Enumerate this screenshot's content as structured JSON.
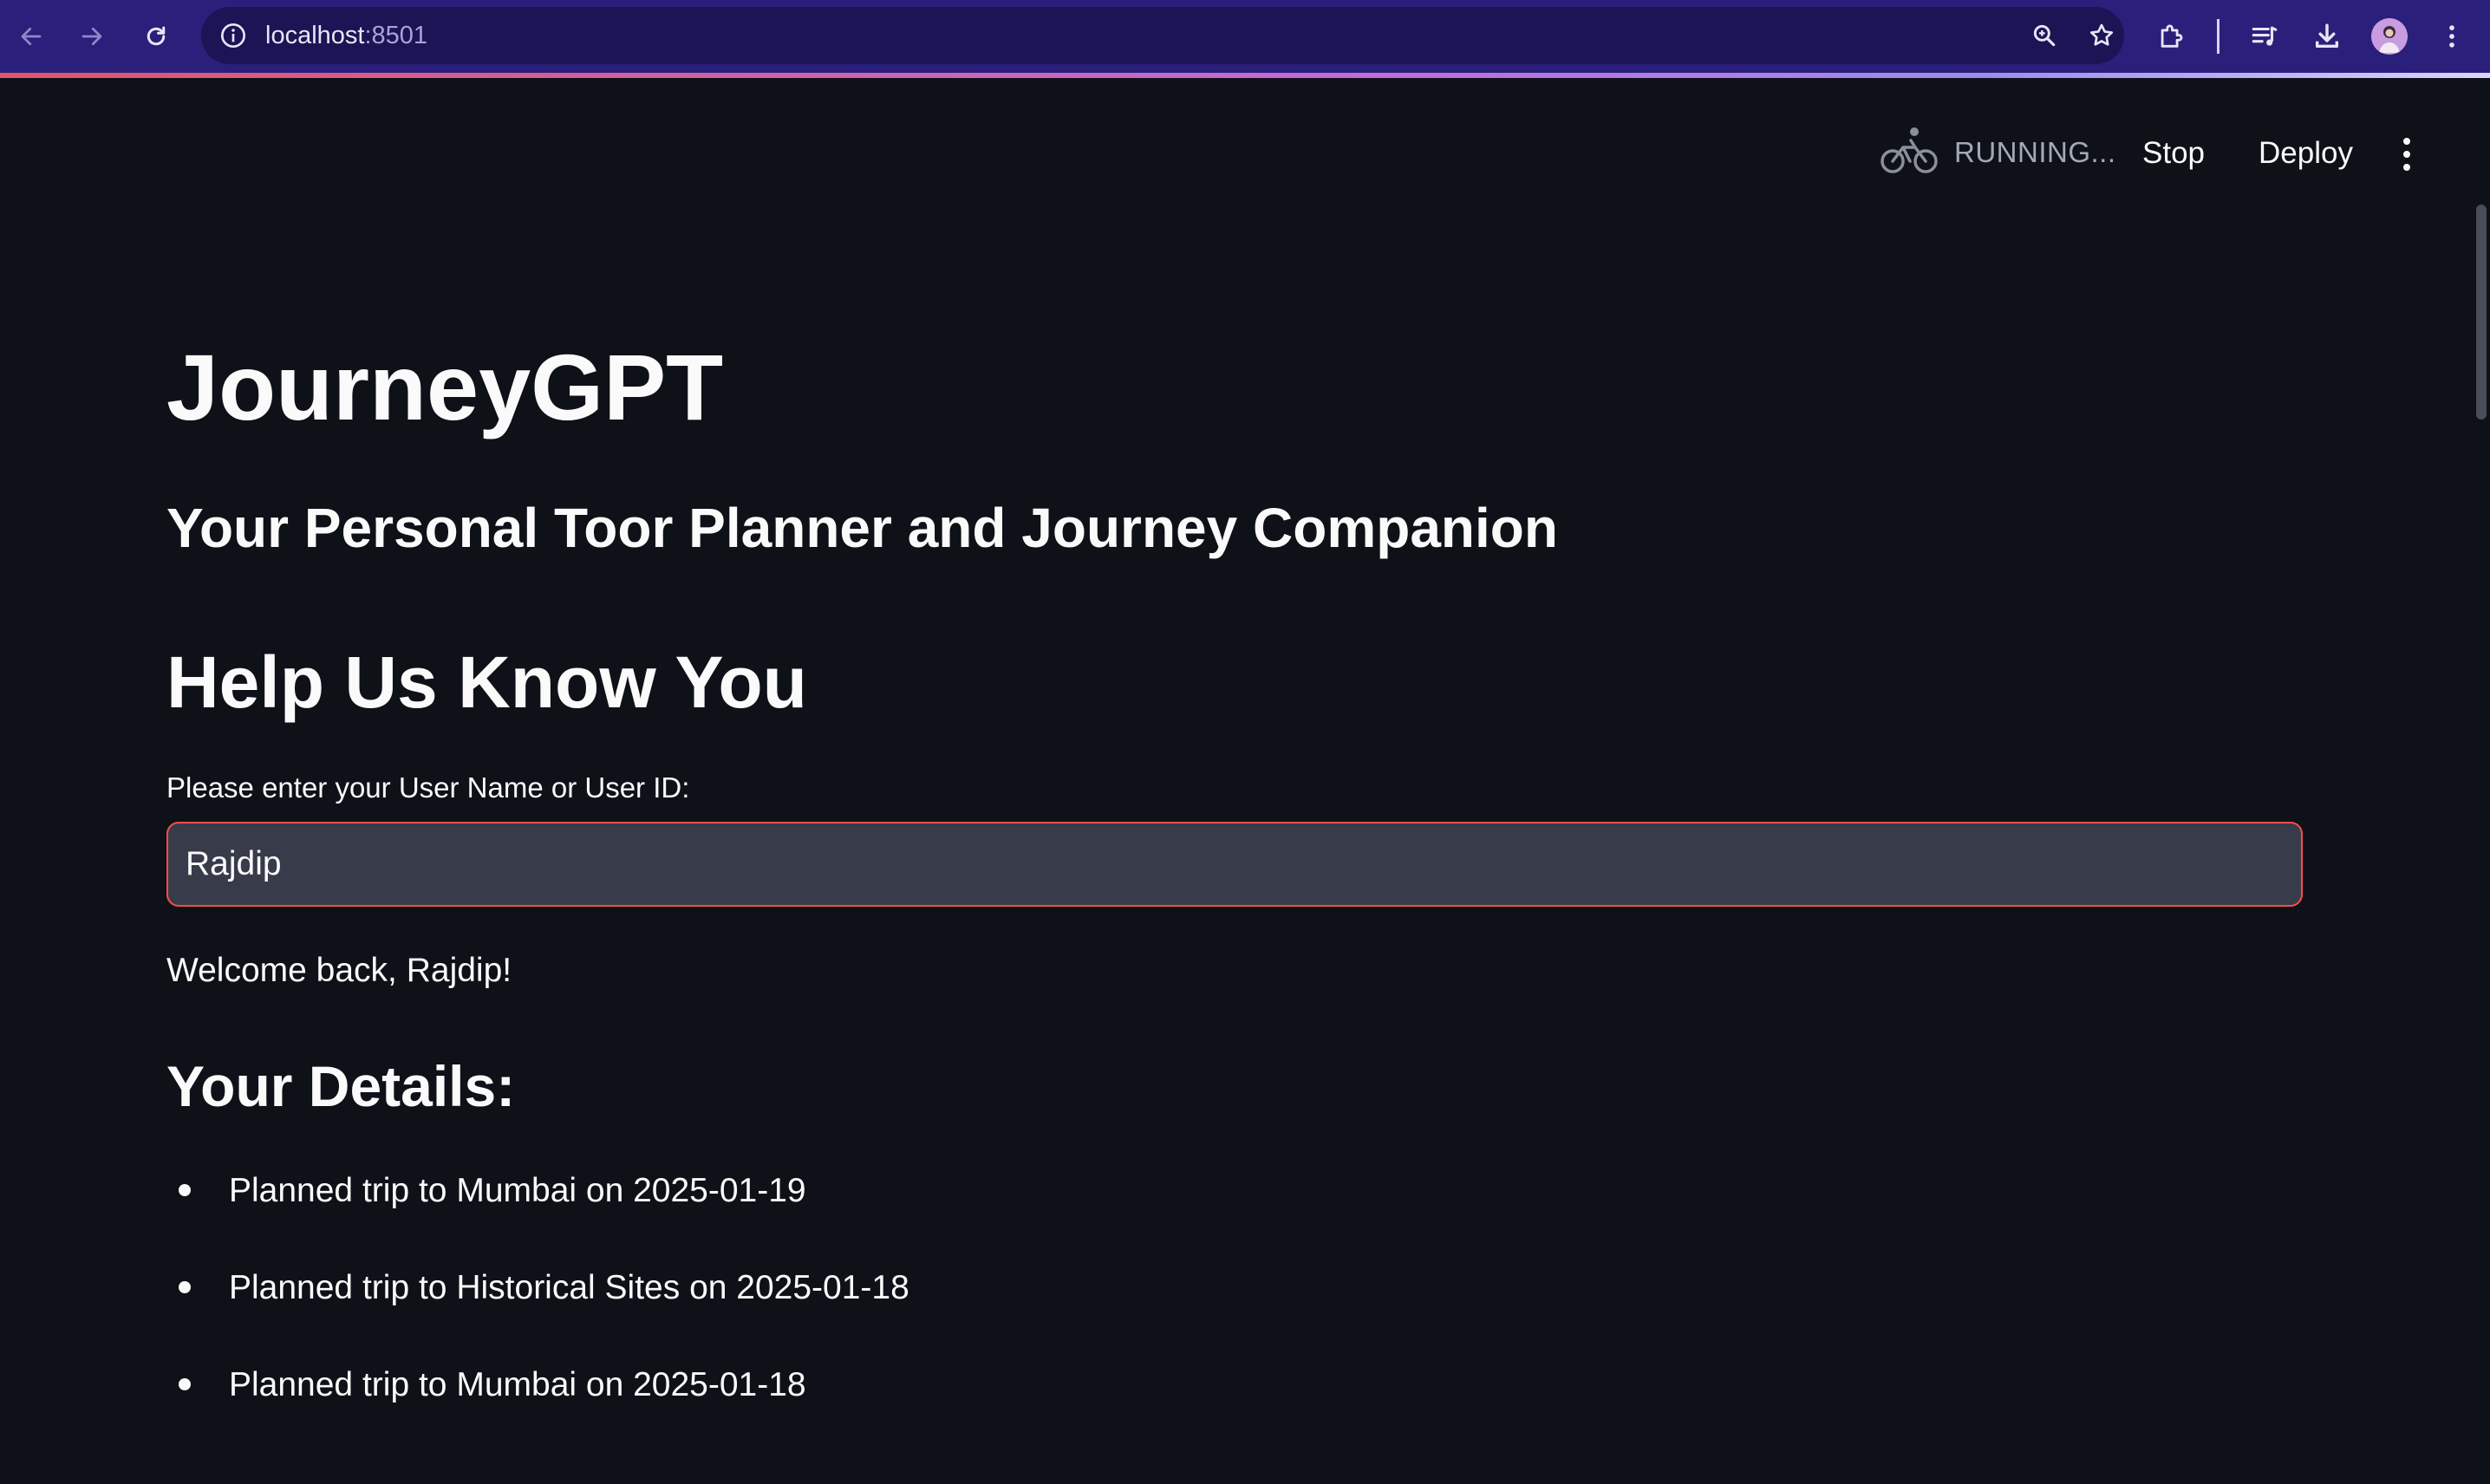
{
  "browser": {
    "url_host": "localhost",
    "url_port": ":8501"
  },
  "header": {
    "status_label": "RUNNING...",
    "stop_label": "Stop",
    "deploy_label": "Deploy"
  },
  "main": {
    "title": "JourneyGPT",
    "subtitle": "Your Personal Toor Planner and Journey Companion",
    "section_title": "Help Us Know You",
    "user_field": {
      "label": "Please enter your User Name or User ID:",
      "value": "Rajdip"
    },
    "welcome_text": "Welcome back, Rajdip!",
    "details_title": "Your Details:",
    "details": [
      "Planned trip to Mumbai on 2025-01-19",
      "Planned trip to Historical Sites on 2025-01-18",
      "Planned trip to Mumbai on 2025-01-18"
    ]
  },
  "colors": {
    "background": "#0e1117",
    "input_border_focus": "#ff4b4b",
    "chrome": "#2a1f7a"
  },
  "icons": [
    "back-arrow-icon",
    "forward-arrow-icon",
    "reload-icon",
    "site-info-icon",
    "zoom-icon",
    "bookmark-star-icon",
    "extensions-icon",
    "media-queue-icon",
    "download-icon",
    "profile-avatar",
    "browser-menu-icon",
    "bicycle-running-icon",
    "app-menu-icon"
  ]
}
